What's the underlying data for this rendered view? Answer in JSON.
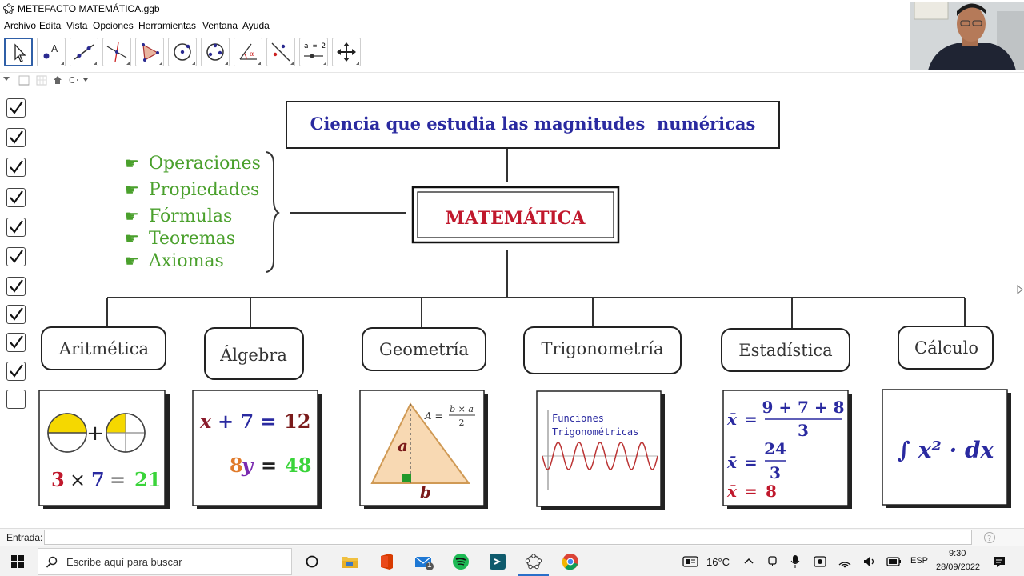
{
  "window": {
    "title": "METEFACTO MATEMÁTICA.ggb"
  },
  "menu": [
    "Archivo",
    "Edita",
    "Vista",
    "Opciones",
    "Herramientas",
    "Ventana",
    "Ayuda"
  ],
  "toolbar": {
    "tools": [
      "move-tool",
      "point-tool",
      "line-tool",
      "perpendicular-tool",
      "polygon-tool",
      "circle-tool",
      "conic-tool",
      "angle-tool",
      "reflect-tool",
      "slider-tool",
      "move-view-tool"
    ],
    "slider_label": "a = 2"
  },
  "diagram": {
    "definition": "Ciencia que estudia las magnitudes  numéricas",
    "title": "MATEMÁTICA",
    "bullet_items": [
      "Operaciones",
      "Propiedades",
      "Fórmulas",
      "Teoremas",
      "Axiomas"
    ],
    "branches": [
      "Aritmética",
      "Álgebra",
      "Geometría",
      "Trigonometría",
      "Estadística",
      "Cálculo"
    ],
    "arith": {
      "n1": "3",
      "op": "×",
      "n2": "7",
      "eq": "=",
      "res": "21"
    },
    "algebra": {
      "eq1_x": "x",
      "eq1_mid": "+ 7 =",
      "eq1_r": "12",
      "eq2_c": "8",
      "eq2_y": "y",
      "eq2_mid": "=",
      "eq2_r": "48"
    },
    "geometry": {
      "formula_lhs": "A =",
      "formula_num": "b × a",
      "formula_den": "2",
      "side_a": "a",
      "side_b": "b"
    },
    "trig": {
      "line1": "Funciones",
      "line2": "Trigonométricas"
    },
    "stats": {
      "sym": "x̄",
      "eq": "=",
      "num1": "9 + 7 + 8",
      "den1": "3",
      "num2": "24",
      "den2": "3",
      "final": "8"
    },
    "calculus": {
      "expr": "∫ x² · dx"
    }
  },
  "checkboxes": {
    "checked": 10,
    "total": 11
  },
  "entry": {
    "label": "Entrada:"
  },
  "taskbar": {
    "search_placeholder": "Escribe aquí para buscar",
    "weather": "16°C",
    "lang": "ESP",
    "time": "9:30",
    "date": "28/09/2022",
    "mail_badge": "1"
  },
  "colors": {
    "title_red": "#c0182c",
    "definition_blue": "#2a2aa0",
    "bullet_green": "#4aa02c",
    "accent_yellow": "#f5d800"
  }
}
